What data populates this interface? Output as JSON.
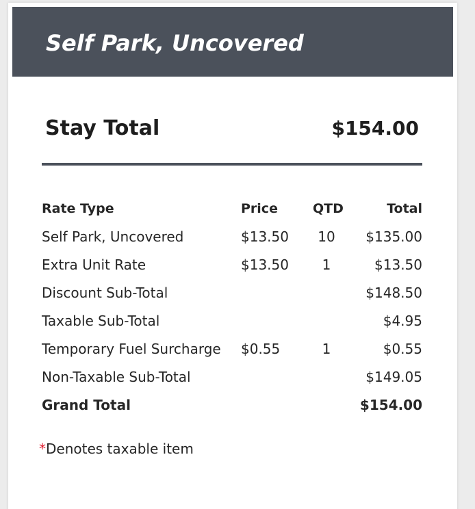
{
  "header": {
    "title": "Self Park, Uncovered"
  },
  "stay_total": {
    "label": "Stay Total",
    "amount": "$154.00"
  },
  "rate_table": {
    "columns": [
      "Rate Type",
      "Price",
      "QTD",
      "Total"
    ],
    "rows": [
      {
        "type": "Self Park, Uncovered",
        "price": "$13.50",
        "qtd": "10",
        "total": "$135.00",
        "bold": false
      },
      {
        "type": "Extra Unit Rate",
        "price": "$13.50",
        "qtd": "1",
        "total": "$13.50",
        "bold": false
      },
      {
        "type": "Discount Sub-Total",
        "price": "",
        "qtd": "",
        "total": "$148.50",
        "bold": false
      },
      {
        "type": "Taxable Sub-Total",
        "price": "",
        "qtd": "",
        "total": "$4.95",
        "bold": false
      },
      {
        "type": "Temporary Fuel Surcharge",
        "price": "$0.55",
        "qtd": "1",
        "total": "$0.55",
        "bold": false
      },
      {
        "type": "Non-Taxable Sub-Total",
        "price": "",
        "qtd": "",
        "total": "$149.05",
        "bold": false
      },
      {
        "type": "Grand Total",
        "price": "",
        "qtd": "",
        "total": "$154.00",
        "bold": true
      }
    ]
  },
  "footnote": {
    "asterisk": "*",
    "text": "Denotes taxable item"
  },
  "colors": {
    "header_bg": "#4b515b",
    "header_text": "#ffffff",
    "asterisk": "#e0192b",
    "divider": "#4b515b"
  }
}
